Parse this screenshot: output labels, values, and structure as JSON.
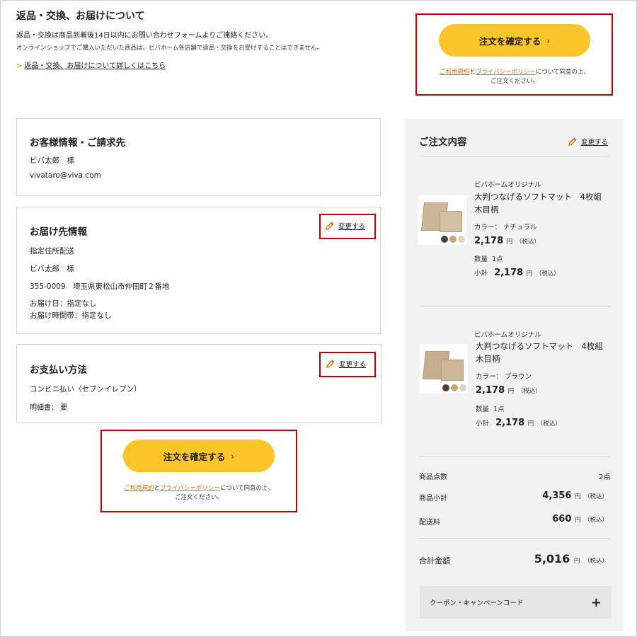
{
  "returns": {
    "title": "返品・交換、お届けについて",
    "line1": "返品・交換は商品到着後14日以内にお問い合わせフォームよりご連絡ください。",
    "line2": "オンラインショップでご購入いただいた商品は、ビバホーム各店舗で返品・交換をお受けすることはできません。",
    "link": "返品・交換、お届けについて詳しくはこちら"
  },
  "confirm": {
    "button_label": "注文を確定する",
    "terms": "ご利用規約",
    "and": "と",
    "privacy": "プライバシーポリシー",
    "note_tail": "について同意の上、",
    "note_line2": "ご注文ください。"
  },
  "customer": {
    "title": "お客様情報・ご請求先",
    "name": "ビバ太郎　様",
    "email": "vivataro@viva.com"
  },
  "delivery": {
    "title": "お届け先情報",
    "edit": "変更する",
    "method": "指定住所配送",
    "name": "ビバ太郎　様",
    "address": "355-0009　埼玉県東松山市仲田町２番地",
    "date": "お届け日：指定なし",
    "time": "お届け時間帯：指定なし"
  },
  "payment": {
    "title": "お支払い方法",
    "edit": "変更する",
    "method": "コンビニ払い（セブンイレブン）",
    "receipt": "明細書： 要"
  },
  "order": {
    "title": "ご注文内容",
    "edit": "変更する",
    "items": [
      {
        "brand": "ビバホームオリジナル",
        "name_line1": "大判つなげるソフトマット　4枚組",
        "name_line2": "木目柄",
        "color": "カラー： ナチュラル",
        "price": "2,178",
        "yen": "円",
        "tax": "（税込）",
        "qty_label": "数量",
        "qty": "1点",
        "subtotal_label": "小計",
        "subtotal": "2,178"
      },
      {
        "brand": "ビバホームオリジナル",
        "name_line1": "大判つなげるソフトマット　4枚組",
        "name_line2": "木目柄",
        "color": "カラー： ブラウン",
        "price": "2,178",
        "yen": "円",
        "tax": "（税込）",
        "qty_label": "数量",
        "qty": "1点",
        "subtotal_label": "小計",
        "subtotal": "2,178"
      }
    ],
    "count_label": "商品点数",
    "count": "2点",
    "subtotal_label": "商品小計",
    "subtotal": "4,356",
    "shipping_label": "配送料",
    "shipping": "660",
    "total_label": "合計金額",
    "total": "5,016",
    "yen": "円",
    "tax": "（税込）"
  },
  "coupon": {
    "label": "クーポン・キャンペーンコード",
    "plus": "+"
  },
  "colors": {
    "accent": "#fcc62b",
    "link": "#e07000",
    "highlight": "#c00000",
    "summary_bg": "#f2f2f2",
    "swatch1": "#5a3e2b",
    "swatch2": "#c9a46e",
    "swatch3": "#e0d2bb"
  }
}
